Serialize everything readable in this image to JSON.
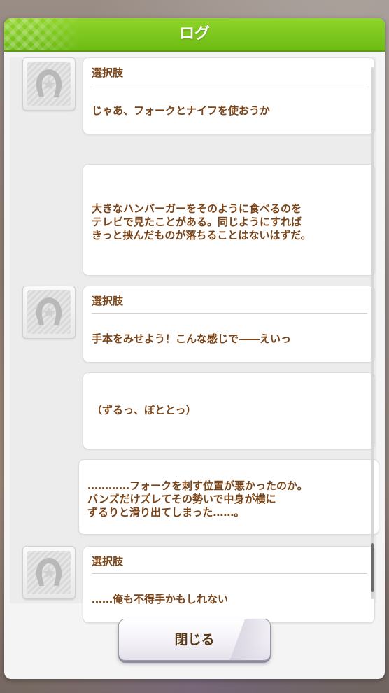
{
  "dialog": {
    "title": "ログ",
    "close_label": "閉じる"
  },
  "log": [
    {
      "type": "choice",
      "label": "選択肢",
      "text": "じゃあ、フォークとナイフを使おうか"
    },
    {
      "type": "narration",
      "text": "大きなハンバーガーをそのように食べるのを\nテレビで見たことがある。同じようにすれば\nきっと挟んだものが落ちることはないはずだ。"
    },
    {
      "type": "choice",
      "label": "選択肢",
      "text": "手本をみせよう！こんな感じで――えいっ"
    },
    {
      "type": "narration",
      "text": "（ずるっ、ぼととっ）"
    },
    {
      "type": "narration",
      "text": "…………フォークを刺す位置が悪かったのか。\nバンズだけズレてその勢いで中身が横に\nずるりと滑り出てしまった……。"
    },
    {
      "type": "choice",
      "label": "選択肢",
      "text": "……俺も不得手かもしれない"
    }
  ],
  "colors": {
    "header_green": "#7cc71e",
    "text_brown": "#7a4418",
    "button_text": "#5a3a16"
  },
  "icons": {
    "avatar": "horseshoe-icon"
  }
}
